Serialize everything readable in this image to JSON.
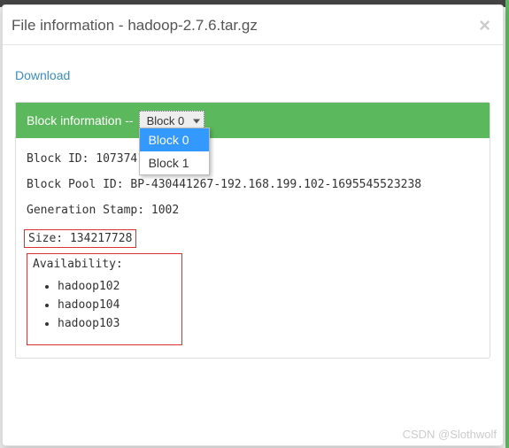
{
  "modal": {
    "title": "File information - hadoop-2.7.6.tar.gz",
    "download_label": "Download"
  },
  "panel": {
    "header_label": "Block information --",
    "select": {
      "selected": "Block 0",
      "options": [
        "Block 0",
        "Block 1"
      ]
    },
    "block_id_label": "Block ID:",
    "block_id_value": "1073741826",
    "block_pool_label": "Block Pool ID:",
    "block_pool_value": "BP-430441267-192.168.199.102-1695545523238",
    "gen_stamp_label": "Generation Stamp:",
    "gen_stamp_value": "1002",
    "size_label": "Size:",
    "size_value": "134217728",
    "availability_label": "Availability:",
    "availability_hosts": [
      "hadoop102",
      "hadoop104",
      "hadoop103"
    ]
  },
  "watermark": "CSDN @Slothwolf"
}
